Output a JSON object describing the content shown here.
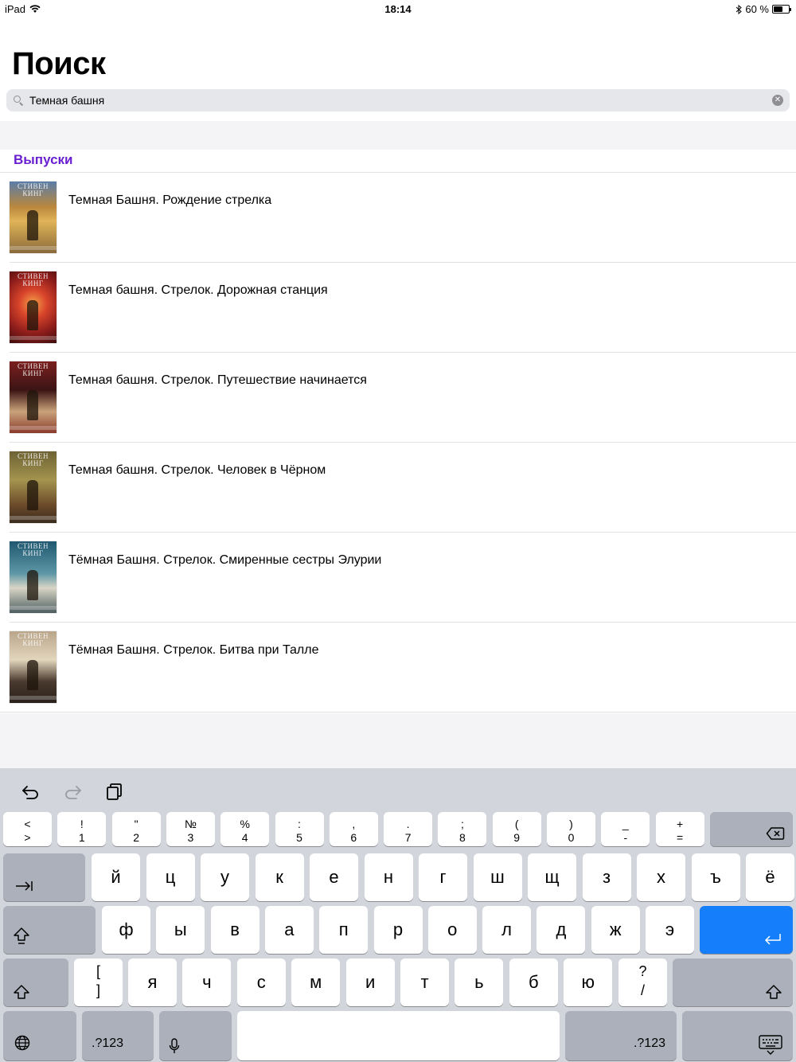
{
  "status_bar": {
    "device": "iPad",
    "time": "18:14",
    "battery_text": "60 %",
    "battery_level": 0.6
  },
  "page": {
    "title": "Поиск"
  },
  "search": {
    "value": "Темная башня",
    "placeholder": ""
  },
  "section": {
    "title": "Выпуски",
    "color": "#6a1fd1"
  },
  "results": [
    {
      "title": "Темная Башня. Рождение стрелка",
      "cover": "c1"
    },
    {
      "title": "Темная башня. Стрелок. Дорожная станция",
      "cover": "c2"
    },
    {
      "title": "Темная башня. Стрелок. Путешествие начинается",
      "cover": "c3"
    },
    {
      "title": "Темная башня. Стрелок. Человек в Чёрном",
      "cover": "c4"
    },
    {
      "title": "Тёмная Башня. Стрелок. Смиренные сестры Элурии",
      "cover": "c5"
    },
    {
      "title": "Тёмная Башня. Стрелок. Битва при Талле",
      "cover": "c6"
    }
  ],
  "keyboard": {
    "row1": [
      {
        "top": "<",
        "bot": ">"
      },
      {
        "top": "!",
        "bot": "1"
      },
      {
        "top": "\"",
        "bot": "2"
      },
      {
        "top": "№",
        "bot": "3"
      },
      {
        "top": "%",
        "bot": "4"
      },
      {
        "top": ":",
        "bot": "5"
      },
      {
        "top": ",",
        "bot": "6"
      },
      {
        "top": ".",
        "bot": "7"
      },
      {
        "top": ";",
        "bot": "8"
      },
      {
        "top": "(",
        "bot": "9"
      },
      {
        "top": ")",
        "bot": "0"
      },
      {
        "top": "_",
        "bot": "-"
      },
      {
        "top": "+",
        "bot": "="
      }
    ],
    "row2": [
      "й",
      "ц",
      "у",
      "к",
      "е",
      "н",
      "г",
      "ш",
      "щ",
      "з",
      "х",
      "ъ",
      "ё"
    ],
    "row3": [
      "ф",
      "ы",
      "в",
      "а",
      "п",
      "р",
      "о",
      "л",
      "д",
      "ж",
      "э"
    ],
    "row4": [
      "я",
      "ч",
      "с",
      "м",
      "и",
      "т",
      "ь",
      "б",
      "ю"
    ],
    "row4_bracket": {
      "top": "[",
      "bot": "]"
    },
    "row4_slash": {
      "top": "?",
      "bot": "/"
    },
    "numbers_label": ".?123",
    "accent_color": "#147efb"
  }
}
